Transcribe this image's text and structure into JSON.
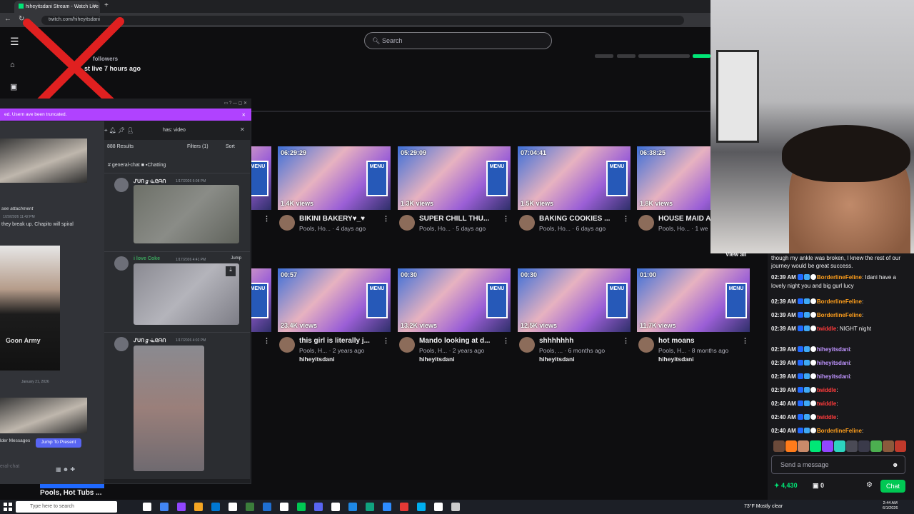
{
  "browser": {
    "tab_title": "hiheyitsdani Stream - Watch Live",
    "url": "twitch.com/hiheyitsdani"
  },
  "twitch": {
    "search_placeholder": "Search",
    "followers_label": "followers",
    "last_live": "st live 7 hours ago",
    "stream_title": "Pools, Hot Tubs ...",
    "videos_row1": [
      {
        "duration": "",
        "views": "",
        "title": "",
        "meta": "",
        "channel": ""
      },
      {
        "duration": "06:29:29",
        "views": "1.4K views",
        "title": "BIKINI BAKERY♥_♥",
        "meta": "Pools, Ho...  · 4 days ago",
        "channel": ""
      },
      {
        "duration": "05:29:09",
        "views": "1.3K views",
        "title": "SUPER CHILL THU...",
        "meta": "Pools, Ho...  · 5 days ago",
        "channel": ""
      },
      {
        "duration": "07:04:41",
        "views": "1.5K views",
        "title": "BAKING COOKIES ...",
        "meta": "Pools, Ho...  · 6 days ago",
        "channel": ""
      },
      {
        "duration": "06:38:25",
        "views": "1.8K views",
        "title": "HOUSE MAID A",
        "meta": "Pools, Ho...  · 1 we",
        "channel": ""
      }
    ],
    "videos_row2": [
      {
        "duration": "",
        "views": "",
        "title": "",
        "meta": "",
        "channel": ""
      },
      {
        "duration": "00:57",
        "views": "23.4K views",
        "title": "this girl is literally j...",
        "meta": "Pools, H...  · 2 years ago",
        "channel": "hiheyitsdani"
      },
      {
        "duration": "00:30",
        "views": "13.2K views",
        "title": "Mando looking at d...",
        "meta": "Pools, H...  · 2 years ago",
        "channel": "hiheyitsdani"
      },
      {
        "duration": "00:30",
        "views": "12.5K views",
        "title": "shhhhhhh",
        "meta": "Pools, ...  · 6 months ago",
        "channel": "hiheyitsdani"
      },
      {
        "duration": "01:00",
        "views": "11.7K views",
        "title": "hot moans",
        "meta": "Pools, H...  · 8 months ago",
        "channel": "hiheyitsdani"
      }
    ],
    "menu_sign": "MENU"
  },
  "discord": {
    "banner": "ed. Usern         ave been truncated.",
    "search_query": "has: video",
    "results_count": "888 Results",
    "filters_label": "Filters (1)",
    "sort_label": "Sort",
    "channel_label": "# general-chat ■ ▪Chatting",
    "messages": [
      {
        "user": "ᔑᑌᑎℊᓍᘓᗩᑎ",
        "time": "1/17/2026 6:08 PM",
        "color": "#dbdee1"
      },
      {
        "user": "i love Coke",
        "time": "1/17/2026 4:41 PM",
        "color": "#3ba55d",
        "jump": "Jump"
      },
      {
        "user": "ᔑᑌᑎℊᓍᘓᗩᑎ",
        "time": "1/17/2026 4:02 PM",
        "color": "#dbdee1"
      }
    ],
    "left_text1": "see attachment",
    "left_text2": "1/20/2026 11:42 PM",
    "left_text3": "they break up. Chapito will spiral",
    "left_date": "January 21, 2026",
    "older_messages": "lder Messages",
    "jump_present": "Jump To Present",
    "input_hint": "eral-chat",
    "shirt_text": "Goon Army"
  },
  "chat": {
    "view_all": "View all",
    "topline": "though my ankle was broken, I knew the rest of our journey would be great success.",
    "messages": [
      {
        "time": "02:39 AM",
        "user": "BorderlineFeline",
        "color": "#ff9f1c",
        "text": "Idani have a lovely night you and big gurl lucy"
      },
      {
        "time": "02:39 AM",
        "user": "BorderlineFeline",
        "color": "#ff9f1c",
        "text": ""
      },
      {
        "time": "02:39 AM",
        "user": "BorderlineFeline",
        "color": "#ff9f1c",
        "text": ""
      },
      {
        "time": "02:39 AM",
        "user": "twiddle",
        "color": "#ff3b3b",
        "text": "NIGHT night"
      },
      {
        "time": "02:39 AM",
        "user": "hiheyitsdani",
        "color": "#bf94ff",
        "text": ""
      },
      {
        "time": "02:39 AM",
        "user": "hiheyitsdani",
        "color": "#bf94ff",
        "text": ""
      },
      {
        "time": "02:39 AM",
        "user": "hiheyitsdani",
        "color": "#bf94ff",
        "text": ""
      },
      {
        "time": "02:39 AM",
        "user": "twiddle",
        "color": "#ff3b3b",
        "text": ""
      },
      {
        "time": "02:40 AM",
        "user": "twiddle",
        "color": "#ff3b3b",
        "text": ""
      },
      {
        "time": "02:40 AM",
        "user": "twiddle",
        "color": "#ff3b3b",
        "text": ""
      },
      {
        "time": "02:40 AM",
        "user": "BorderlineFeline",
        "color": "#ff9f1c",
        "text": ""
      }
    ],
    "input_placeholder": "Send a message",
    "points": "4,430",
    "bits": "0",
    "chat_button": "Chat"
  },
  "taskbar": {
    "search_placeholder": "Type here to search",
    "weather": "73°F  Mostly clear",
    "time": "2:44 AM",
    "date": "6/1/2026"
  }
}
